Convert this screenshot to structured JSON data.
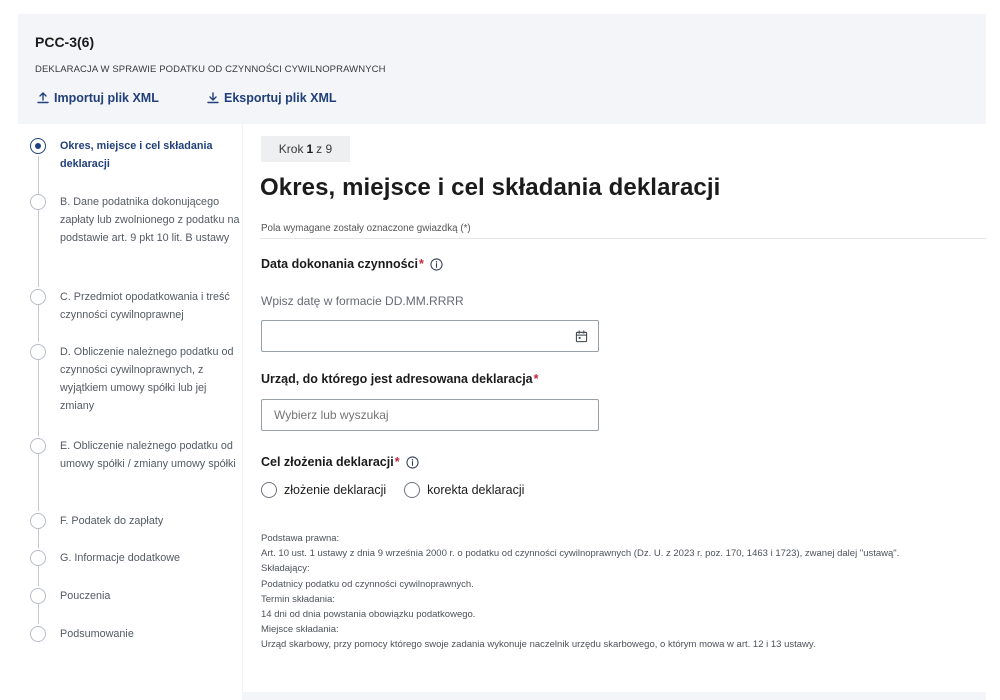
{
  "header": {
    "form_code": "PCC-3(6)",
    "form_subtitle": "DEKLARACJA W SPRAWIE PODATKU OD CZYNNOŚCI CYWILNOPRAWNYCH",
    "import_label": "Importuj plik XML",
    "export_label": "Eksportuj plik XML"
  },
  "stepper": {
    "steps": [
      {
        "label": "Okres, miejsce i cel składania deklaracji",
        "active": true
      },
      {
        "label": "B. Dane podatnika dokonującego zapłaty lub zwolnionego z podatku na podstawie art. 9 pkt 10 lit. B ustawy",
        "active": false
      },
      {
        "label": "C. Przedmiot opodatkowania i treść czynności cywilnoprawnej",
        "active": false
      },
      {
        "label": "D. Obliczenie należnego podatku od czynności cywilnoprawnych, z wyjątkiem umowy spółki lub jej zmiany",
        "active": false
      },
      {
        "label": "E. Obliczenie należnego podatku od umowy spółki / zmiany umowy spółki",
        "active": false
      },
      {
        "label": "F. Podatek do zapłaty",
        "active": false
      },
      {
        "label": "G. Informacje dodatkowe",
        "active": false
      },
      {
        "label": "Pouczenia",
        "active": false
      },
      {
        "label": "Podsumowanie",
        "active": false
      }
    ]
  },
  "main": {
    "step_prefix": "Krok",
    "step_current": "1",
    "step_suffix": "z 9",
    "title": "Okres, miejsce i cel składania deklaracji",
    "required_note": "Pola wymagane zostały oznaczone gwiazdką (*)",
    "date_field": {
      "label": "Data dokonania czynności",
      "hint": "Wpisz datę w formacie DD.MM.RRRR",
      "value": ""
    },
    "office_field": {
      "label": "Urząd, do którego jest adresowana deklaracja",
      "placeholder": "Wybierz lub wyszukaj"
    },
    "purpose_field": {
      "label": "Cel złożenia deklaracji",
      "options": [
        "złożenie deklaracji",
        "korekta deklaracji"
      ]
    },
    "asterisk": "*",
    "legal_lines": [
      "Podstawa prawna:",
      "Art. 10 ust. 1 ustawy z dnia 9 września 2000 r. o podatku od czynności cywilnoprawnych (Dz. U. z 2023 r. poz. 170, 1463 i 1723), zwanej dalej \"ustawą\".",
      "Składający:",
      "Podatnicy podatku od czynności cywilnoprawnych.",
      "Termin składania:",
      "14 dni od dnia powstania obowiązku podatkowego.",
      "Miejsce składania:",
      "Urząd skarbowy, przy pomocy którego swoje zadania wykonuje naczelnik urzędu skarbowego, o którym mowa w art. 12 i 13 ustawy."
    ]
  },
  "colors": {
    "accent": "#213f7a",
    "required": "#c0263c",
    "header_bg": "#f3f5f9"
  },
  "icons": {
    "import": "upload-icon",
    "export": "download-icon",
    "info": "info-icon",
    "calendar": "calendar-icon"
  }
}
